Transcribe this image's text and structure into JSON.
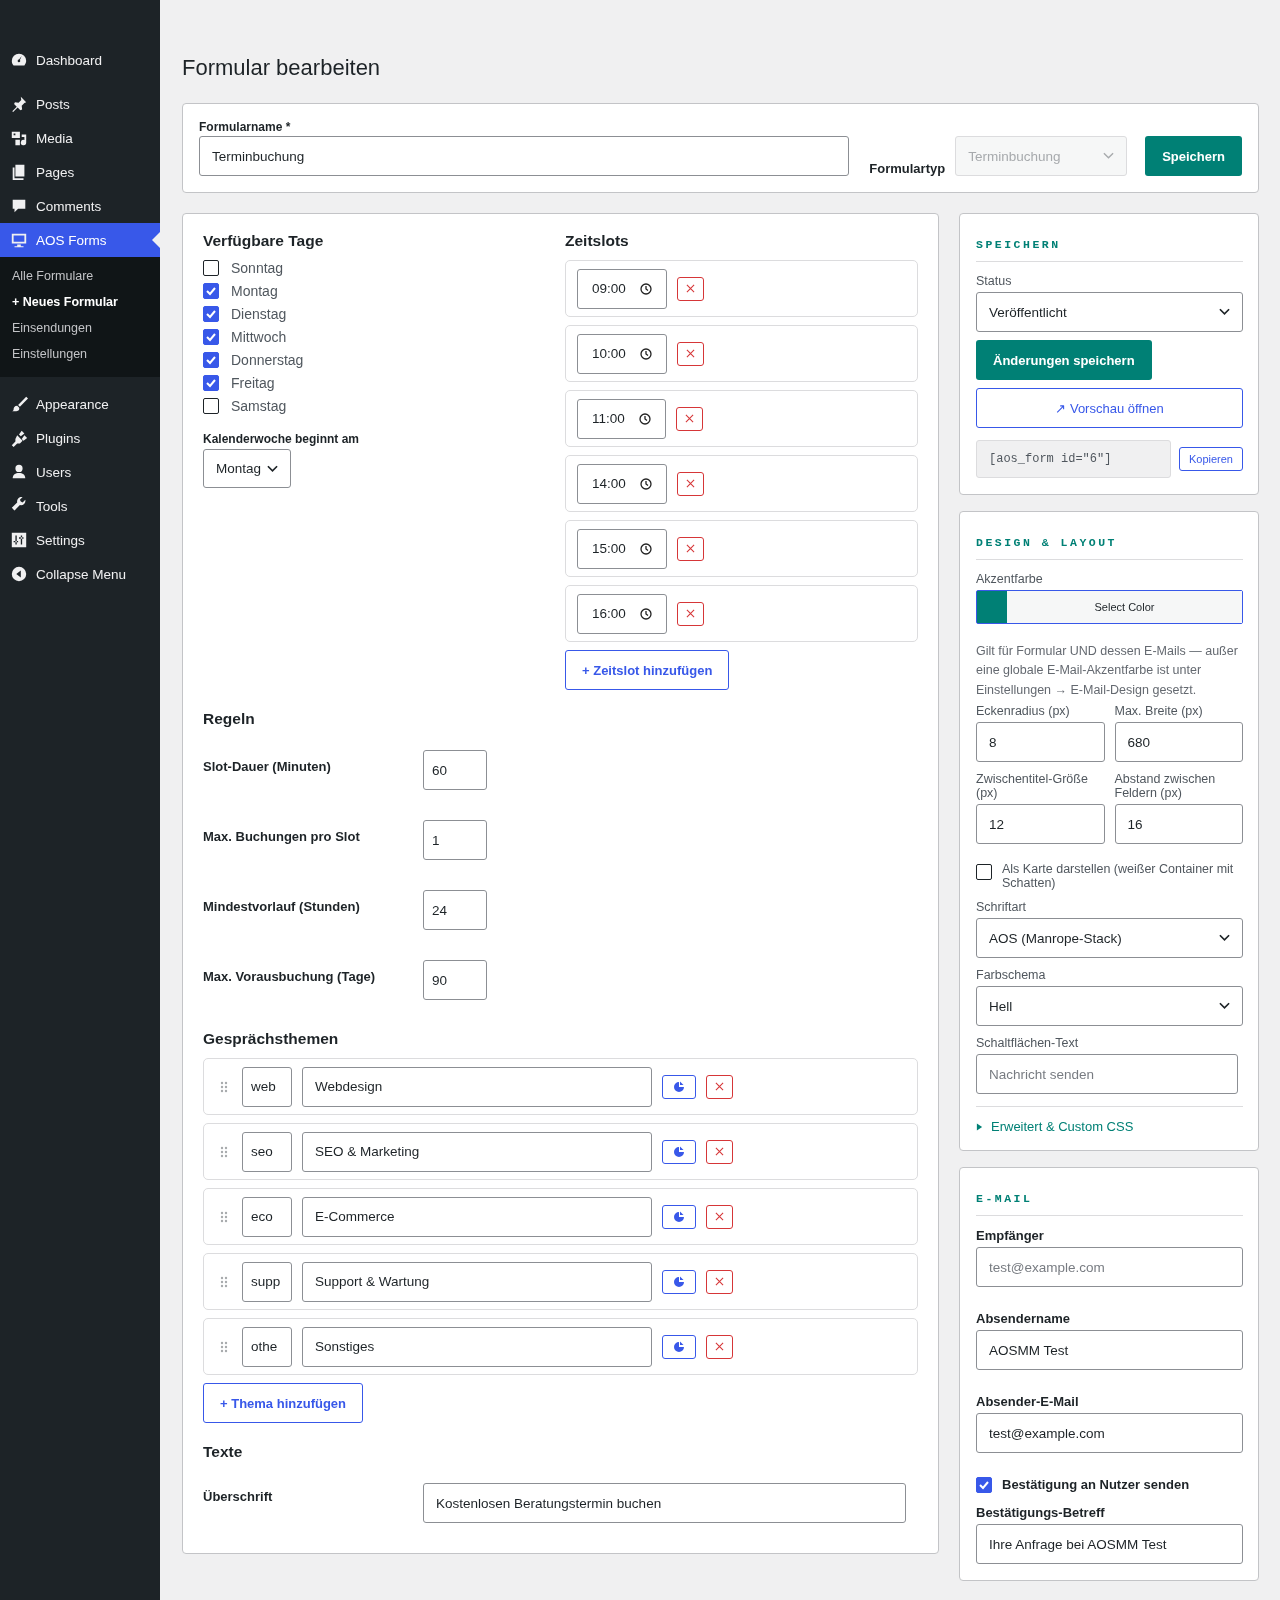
{
  "sidebar": {
    "items": [
      {
        "label": "Dashboard",
        "selected": false
      },
      {
        "label": "Posts",
        "selected": false
      },
      {
        "label": "Media",
        "selected": false
      },
      {
        "label": "Pages",
        "selected": false
      },
      {
        "label": "Comments",
        "selected": false
      },
      {
        "label": "AOS Forms",
        "selected": true,
        "submenu": [
          {
            "label": "Alle Formulare",
            "selected": false
          },
          {
            "label": "+ Neues Formular",
            "selected": true
          },
          {
            "label": "Einsendungen",
            "selected": false
          },
          {
            "label": "Einstellungen",
            "selected": false
          }
        ]
      },
      {
        "label": "Appearance",
        "selected": false
      },
      {
        "label": "Plugins",
        "selected": false
      },
      {
        "label": "Users",
        "selected": false
      },
      {
        "label": "Tools",
        "selected": false
      },
      {
        "label": "Settings",
        "selected": false
      },
      {
        "label": "Collapse Menu",
        "selected": false
      }
    ]
  },
  "page_title": "Formular bearbeiten",
  "form_header": {
    "name_label": "Formularname *",
    "name_value": "Terminbuchung",
    "type_label": "Formulartyp",
    "type_value": "Terminbuchung",
    "type_disabled": true,
    "save_button": "Speichern"
  },
  "days": {
    "title": "Verfügbare Tage",
    "items": [
      {
        "label": "Sonntag",
        "checked": false
      },
      {
        "label": "Montag",
        "checked": true
      },
      {
        "label": "Dienstag",
        "checked": true
      },
      {
        "label": "Mittwoch",
        "checked": true
      },
      {
        "label": "Donnerstag",
        "checked": true
      },
      {
        "label": "Freitag",
        "checked": true
      },
      {
        "label": "Samstag",
        "checked": false
      }
    ],
    "week_start_label": "Kalenderwoche beginnt am",
    "week_start_value": "Montag"
  },
  "timeslots": {
    "title": "Zeitslots",
    "items": [
      {
        "time": "09:00"
      },
      {
        "time": "10:00"
      },
      {
        "time": "11:00"
      },
      {
        "time": "14:00"
      },
      {
        "time": "15:00"
      },
      {
        "time": "16:00"
      }
    ],
    "add_button": "+ Zeitslot hinzufügen"
  },
  "rules": {
    "title": "Regeln",
    "items": [
      {
        "label": "Slot-Dauer (Minuten)",
        "value": "60"
      },
      {
        "label": "Max. Buchungen pro Slot",
        "value": "1"
      },
      {
        "label": "Mindestvorlauf (Stunden)",
        "value": "24"
      },
      {
        "label": "Max. Vorausbuchung (Tage)",
        "value": "90"
      }
    ]
  },
  "topics": {
    "title": "Gesprächsthemen",
    "items": [
      {
        "slug": "web",
        "label": "Webdesign"
      },
      {
        "slug": "seo",
        "label": "SEO & Marketing"
      },
      {
        "slug": "eco",
        "label": "E-Commerce"
      },
      {
        "slug": "supp",
        "label": "Support & Wartung"
      },
      {
        "slug": "othe",
        "label": "Sonstiges"
      }
    ],
    "add_button": "+ Thema hinzufügen"
  },
  "texts": {
    "title": "Texte",
    "items": [
      {
        "label": "Überschrift",
        "value": "Kostenlosen Beratungstermin buchen"
      }
    ]
  },
  "save_panel": {
    "title": "SPEICHERN",
    "status_label": "Status",
    "status_value": "Veröffentlicht",
    "save_button": "Änderungen speichern",
    "preview_button": "↗ Vorschau öffnen",
    "shortcode": "[aos_form id=\"6\"]",
    "copy_button": "Kopieren"
  },
  "design_panel": {
    "title": "DESIGN & LAYOUT",
    "accent_label": "Akzentfarbe",
    "select_color_button": "Select Color",
    "note": "Gilt für Formular UND dessen E-Mails — außer eine globale E-Mail-Akzentfarbe ist unter Einstellungen → E-Mail-Design gesetzt.",
    "number_fields": [
      {
        "label": "Eckenradius (px)",
        "value": "8"
      },
      {
        "label": "Max. Breite (px)",
        "value": "680"
      },
      {
        "label": "Zwischentitel-Größe (px)",
        "value": "12"
      },
      {
        "label": "Abstand zwischen Feldern (px)",
        "value": "16"
      }
    ],
    "card_option": {
      "label": "Als Karte darstellen (weißer Container mit Schatten)",
      "checked": false
    },
    "font_label": "Schriftart",
    "font_value": "AOS (Manrope-Stack)",
    "scheme_label": "Farbschema",
    "scheme_value": "Hell",
    "button_text_label": "Schaltflächen-Text",
    "button_text_placeholder": "Nachricht senden",
    "advanced_link": "Erweitert & Custom CSS",
    "advanced_expanded": false
  },
  "email_panel": {
    "title": "E-MAIL",
    "recipient_label": "Empfänger",
    "recipient_placeholder": "test@example.com",
    "sender_name_label": "Absendername",
    "sender_name_value": "AOSMM Test",
    "sender_email_label": "Absender-E-Mail",
    "sender_email_value": "test@example.com",
    "confirm_option": {
      "label": "Bestätigung an Nutzer senden",
      "checked": true
    },
    "subject_label": "Bestätigungs-Betreff",
    "subject_value": "Ihre Anfrage bei AOSMM Test"
  }
}
